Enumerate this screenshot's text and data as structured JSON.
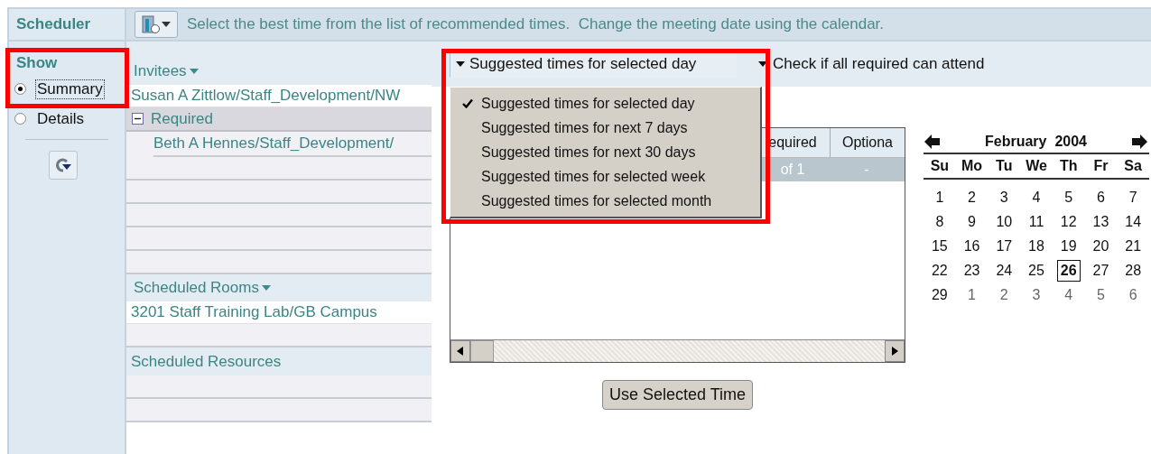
{
  "sidebar": {
    "title": "Scheduler",
    "show": {
      "label": "Show",
      "highlighted": true,
      "options": [
        {
          "label": "Summary",
          "selected": true,
          "focused": true
        },
        {
          "label": "Details",
          "selected": false,
          "focused": false
        }
      ]
    }
  },
  "instruction": "Select the best time from the list of recommended times.  Change the meeting date using the calendar.",
  "invitees": {
    "heading": "Invitees",
    "rows": [
      {
        "kind": "person",
        "text": "Susan A Zittlow/Staff_Development/NW"
      },
      {
        "kind": "group",
        "text": "Required",
        "expanded": true
      },
      {
        "kind": "member",
        "text": "Beth A Hennes/Staff_Development/"
      }
    ]
  },
  "rooms": {
    "heading": "Scheduled Rooms",
    "rows": [
      "3201 Staff Training Lab/GB Campus"
    ]
  },
  "resources": {
    "heading": "Scheduled Resources"
  },
  "range_menu": {
    "value": "Suggested times for selected day",
    "open": true,
    "highlighted": true,
    "options": [
      {
        "label": "Suggested times for selected day",
        "selected": true
      },
      {
        "label": "Suggested times for next 7 days",
        "selected": false
      },
      {
        "label": "Suggested times for next 30 days",
        "selected": false
      },
      {
        "label": "Suggested times for selected week",
        "selected": false
      },
      {
        "label": "Suggested times for selected month",
        "selected": false
      }
    ]
  },
  "attend_check": "Check if all required can attend",
  "results_table": {
    "columns": [
      "equired",
      "Optiona"
    ],
    "rows": [
      [
        "of 1",
        "-"
      ]
    ]
  },
  "calendar": {
    "month": "February  2004",
    "weekdays": [
      "Su",
      "Mo",
      "Tu",
      "We",
      "Th",
      "Fr",
      "Sa"
    ],
    "days": [
      {
        "label": "1",
        "other_month": false,
        "selected": false
      },
      {
        "label": "2",
        "other_month": false,
        "selected": false
      },
      {
        "label": "3",
        "other_month": false,
        "selected": false
      },
      {
        "label": "4",
        "other_month": false,
        "selected": false
      },
      {
        "label": "5",
        "other_month": false,
        "selected": false
      },
      {
        "label": "6",
        "other_month": false,
        "selected": false
      },
      {
        "label": "7",
        "other_month": false,
        "selected": false
      },
      {
        "label": "8",
        "other_month": false,
        "selected": false
      },
      {
        "label": "9",
        "other_month": false,
        "selected": false
      },
      {
        "label": "10",
        "other_month": false,
        "selected": false
      },
      {
        "label": "11",
        "other_month": false,
        "selected": false
      },
      {
        "label": "12",
        "other_month": false,
        "selected": false
      },
      {
        "label": "13",
        "other_month": false,
        "selected": false
      },
      {
        "label": "14",
        "other_month": false,
        "selected": false
      },
      {
        "label": "15",
        "other_month": false,
        "selected": false
      },
      {
        "label": "16",
        "other_month": false,
        "selected": false
      },
      {
        "label": "17",
        "other_month": false,
        "selected": false
      },
      {
        "label": "18",
        "other_month": false,
        "selected": false
      },
      {
        "label": "19",
        "other_month": false,
        "selected": false
      },
      {
        "label": "20",
        "other_month": false,
        "selected": false
      },
      {
        "label": "21",
        "other_month": false,
        "selected": false
      },
      {
        "label": "22",
        "other_month": false,
        "selected": false
      },
      {
        "label": "23",
        "other_month": false,
        "selected": false
      },
      {
        "label": "24",
        "other_month": false,
        "selected": false
      },
      {
        "label": "25",
        "other_month": false,
        "selected": false
      },
      {
        "label": "26",
        "other_month": false,
        "selected": true
      },
      {
        "label": "27",
        "other_month": false,
        "selected": false
      },
      {
        "label": "28",
        "other_month": false,
        "selected": false
      },
      {
        "label": "29",
        "other_month": false,
        "selected": false
      },
      {
        "label": "1",
        "other_month": true,
        "selected": false
      },
      {
        "label": "2",
        "other_month": true,
        "selected": false
      },
      {
        "label": "3",
        "other_month": true,
        "selected": false
      },
      {
        "label": "4",
        "other_month": true,
        "selected": false
      },
      {
        "label": "5",
        "other_month": true,
        "selected": false
      },
      {
        "label": "6",
        "other_month": true,
        "selected": false
      }
    ]
  },
  "use_button": "Use Selected Time"
}
